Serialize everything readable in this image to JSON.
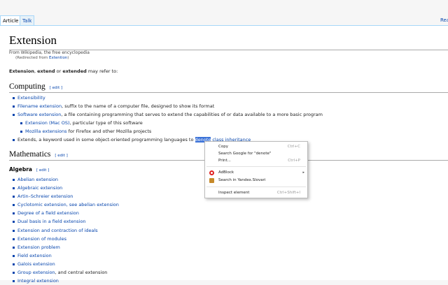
{
  "tabs": {
    "article": "Article",
    "talk": "Talk",
    "read": "Rea"
  },
  "page": {
    "title": "Extension",
    "subtitle": "From Wikipedia, the free encyclopedia",
    "redirect_prefix": "(Redirected from ",
    "redirect_link": "Extention",
    "redirect_suffix": ")",
    "intro_bold_1": "Extension",
    "intro_sep_1": ", ",
    "intro_bold_2": "extend",
    "intro_sep_2": " or ",
    "intro_bold_3": "extended",
    "intro_rest": " may refer to:"
  },
  "edit_label": "[ edit ]",
  "computing": {
    "heading": "Computing",
    "items": [
      {
        "link": "Extensibility",
        "text": ""
      },
      {
        "link": "Filename extension",
        "text": ", suffix to the name of a computer file, designed to show its format"
      },
      {
        "link": "Software extension",
        "text": ", a file containing programming that serves to extend the capabilities of or data available to a more basic program"
      }
    ],
    "subitems": [
      {
        "link": "Extension (Mac OS)",
        "text": ", particular type of this software"
      },
      {
        "link": "Mozilla extensions",
        "text": " for Firefox and other Mozilla projects"
      }
    ],
    "extends_prefix": "Extends, a keyword used in some object-oriented programming languages to ",
    "extends_selected": "denote",
    "extends_suffix": " class inheritance"
  },
  "mathematics": {
    "heading": "Mathematics",
    "algebra_heading": "Algebra",
    "items": [
      {
        "link": "Abelian extension",
        "text": ""
      },
      {
        "link": "Algebraic extension",
        "text": ""
      },
      {
        "link": "Artin–Schreier extension",
        "text": ""
      },
      {
        "link": "Cyclotomic extension, see abelian extension",
        "text": ""
      },
      {
        "link": "Degree of a field extension",
        "text": ""
      },
      {
        "link": "Dual basis in a field extension",
        "text": ""
      },
      {
        "link": "Extension and contraction of ideals",
        "text": ""
      },
      {
        "link": "Extension of modules",
        "text": ""
      },
      {
        "link": "Extension problem",
        "text": ""
      },
      {
        "link": "Field extension",
        "text": ""
      },
      {
        "link": "Galois extension",
        "text": ""
      },
      {
        "link": "Group extension",
        "text": ", and central extension"
      },
      {
        "link": "Integral extension",
        "text": ""
      }
    ]
  },
  "context_menu": {
    "copy": "Copy",
    "copy_shortcut": "Ctrl+C",
    "search_google": "Search Google for \"denote\"",
    "print": "Print...",
    "print_shortcut": "Ctrl+P",
    "adblock": "AdBlock",
    "yandex": "Search in Yandex.Slovari",
    "inspect": "Inspect element",
    "inspect_shortcut": "Ctrl+Shift+I",
    "adblock_icon": "adblock-icon",
    "yandex_icon": "yandex-icon",
    "submenu_icon": "chevron-right-icon"
  }
}
